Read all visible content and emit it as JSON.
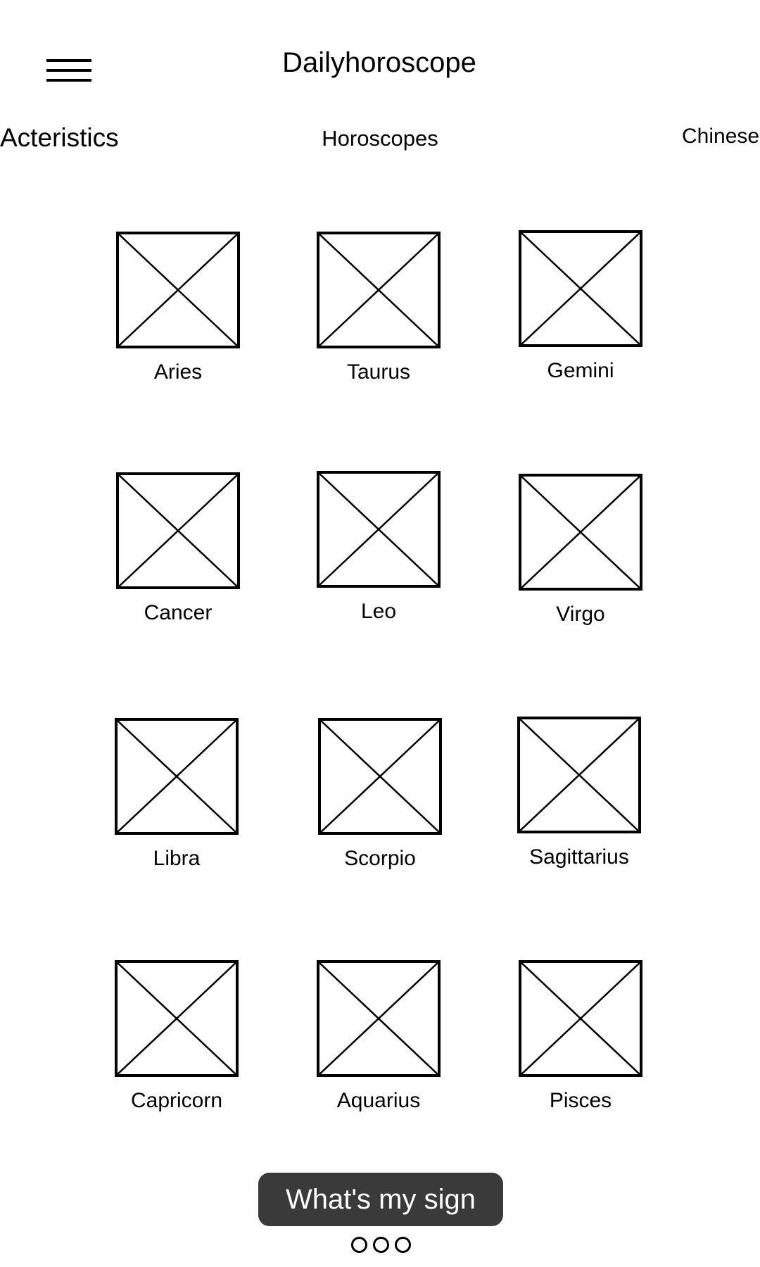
{
  "header": {
    "title": "Dailyhoroscope",
    "menu_icon": "hamburger-menu-icon"
  },
  "tabs": [
    {
      "label": "Acteristics"
    },
    {
      "label": "Horoscopes"
    },
    {
      "label": "Chinese"
    }
  ],
  "signs": [
    {
      "label": "Aries",
      "icon": "image-placeholder-icon"
    },
    {
      "label": "Taurus",
      "icon": "image-placeholder-icon"
    },
    {
      "label": "Gemini",
      "icon": "image-placeholder-icon"
    },
    {
      "label": "Cancer",
      "icon": "image-placeholder-icon"
    },
    {
      "label": "Leo",
      "icon": "image-placeholder-icon"
    },
    {
      "label": "Virgo",
      "icon": "image-placeholder-icon"
    },
    {
      "label": "Libra",
      "icon": "image-placeholder-icon"
    },
    {
      "label": "Scorpio",
      "icon": "image-placeholder-icon"
    },
    {
      "label": "Sagittarius",
      "icon": "image-placeholder-icon"
    },
    {
      "label": "Capricorn",
      "icon": "image-placeholder-icon"
    },
    {
      "label": "Aquarius",
      "icon": "image-placeholder-icon"
    },
    {
      "label": "Pisces",
      "icon": "image-placeholder-icon"
    }
  ],
  "action": {
    "label": "What's my sign",
    "background": "#3a3a3a",
    "text_color": "#ffffff"
  },
  "pager": {
    "pages": 3
  }
}
